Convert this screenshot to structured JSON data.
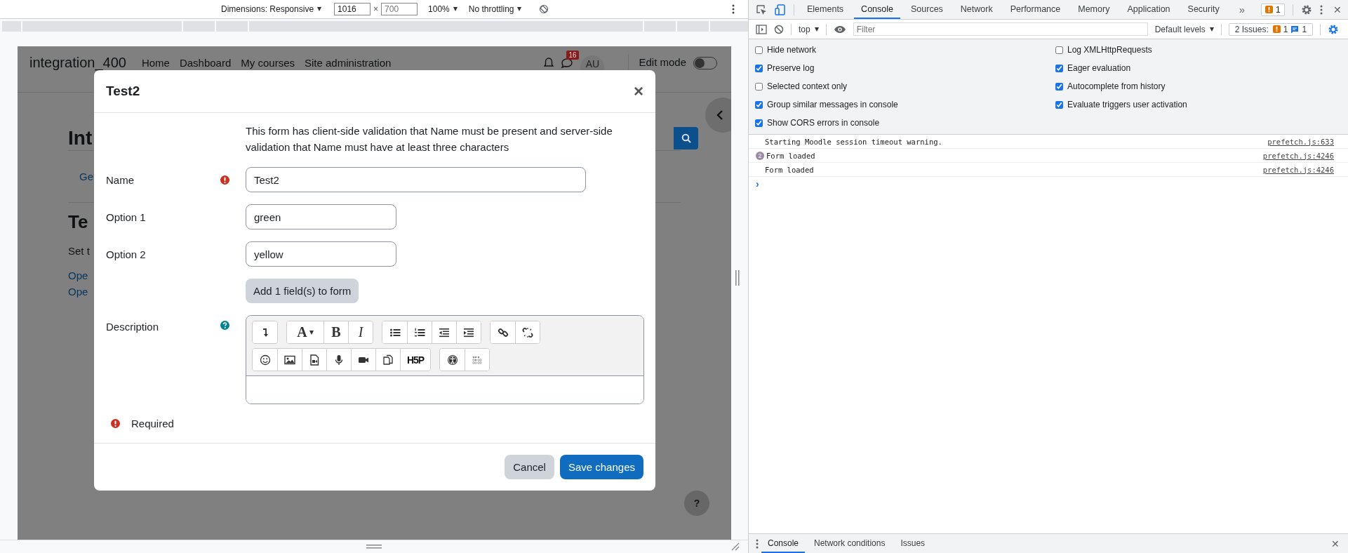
{
  "device_toolbar": {
    "dimensions": "Dimensions: Responsive",
    "width_value": "1016",
    "times": "×",
    "height_placeholder": "700",
    "zoom": "100%",
    "throttling": "No throttling"
  },
  "page": {
    "site_name": "integration_400",
    "nav": [
      "Home",
      "Dashboard",
      "My courses",
      "Site administration"
    ],
    "notification_count": "16",
    "avatar": "AU",
    "edit_mode": {
      "label": "Edit mode",
      "on": false
    },
    "heading": "Int",
    "tab": "Ge",
    "title": "Te",
    "intro": "Set t",
    "links": [
      "Ope",
      "Ope"
    ],
    "help": "?"
  },
  "modal": {
    "title": "Test2",
    "close": "×",
    "intro": "This form has client-side validation that Name must be present and server-side validation that Name must have at least three characters",
    "name_field": {
      "label": "Name",
      "required": true,
      "value": "Test2"
    },
    "options": [
      {
        "label": "Option 1",
        "value": "green"
      },
      {
        "label": "Option 2",
        "value": "yellow"
      }
    ],
    "add_button": "Add 1 field(s) to form",
    "description": {
      "label": "Description",
      "help": true,
      "font": "A",
      "bold": "B",
      "italic": "I",
      "h5p": "H5P"
    },
    "required_note": "Required",
    "buttons": [
      {
        "label": "Cancel",
        "kind": "secondary"
      },
      {
        "label": "Save changes",
        "kind": "primary"
      }
    ]
  },
  "devtools": {
    "tabs": [
      {
        "label": "Elements",
        "selected": false
      },
      {
        "label": "Console",
        "selected": true
      },
      {
        "label": "Sources",
        "selected": false
      },
      {
        "label": "Network",
        "selected": false
      },
      {
        "label": "Performance",
        "selected": false
      },
      {
        "label": "Memory",
        "selected": false
      },
      {
        "label": "Application",
        "selected": false
      },
      {
        "label": "Security",
        "selected": false
      }
    ],
    "more": "»",
    "warning_count": "1",
    "close": "✕",
    "context": "top",
    "filter_placeholder": "Filter",
    "levels": "Default levels",
    "issues_label": "2 Issues:",
    "issues_warnings": "1",
    "issues_info": "1",
    "settings": [
      {
        "label": "Hide network",
        "checked": false
      },
      {
        "label": "Preserve log",
        "checked": true
      },
      {
        "label": "Selected context only",
        "checked": false
      },
      {
        "label": "Group similar messages in console",
        "checked": true
      },
      {
        "label": "Show CORS errors in console",
        "checked": true
      },
      {
        "label": "Log XMLHttpRequests",
        "checked": false
      },
      {
        "label": "Eager evaluation",
        "checked": true
      },
      {
        "label": "Autocomplete from history",
        "checked": true
      },
      {
        "label": "Evaluate triggers user activation",
        "checked": true
      }
    ],
    "messages": [
      {
        "text": "Starting Moodle session timeout warning.",
        "source": "prefetch.js:633"
      },
      {
        "text": "Form loaded",
        "count": "2",
        "source": "prefetch.js:4246"
      },
      {
        "text": "Form loaded",
        "source": "prefetch.js:4246"
      }
    ],
    "prompt": "›",
    "drawer_tabs": [
      {
        "label": "Console",
        "selected": true
      },
      {
        "label": "Network conditions",
        "selected": false
      },
      {
        "label": "Issues",
        "selected": false
      }
    ],
    "drawer_close": "✕"
  }
}
